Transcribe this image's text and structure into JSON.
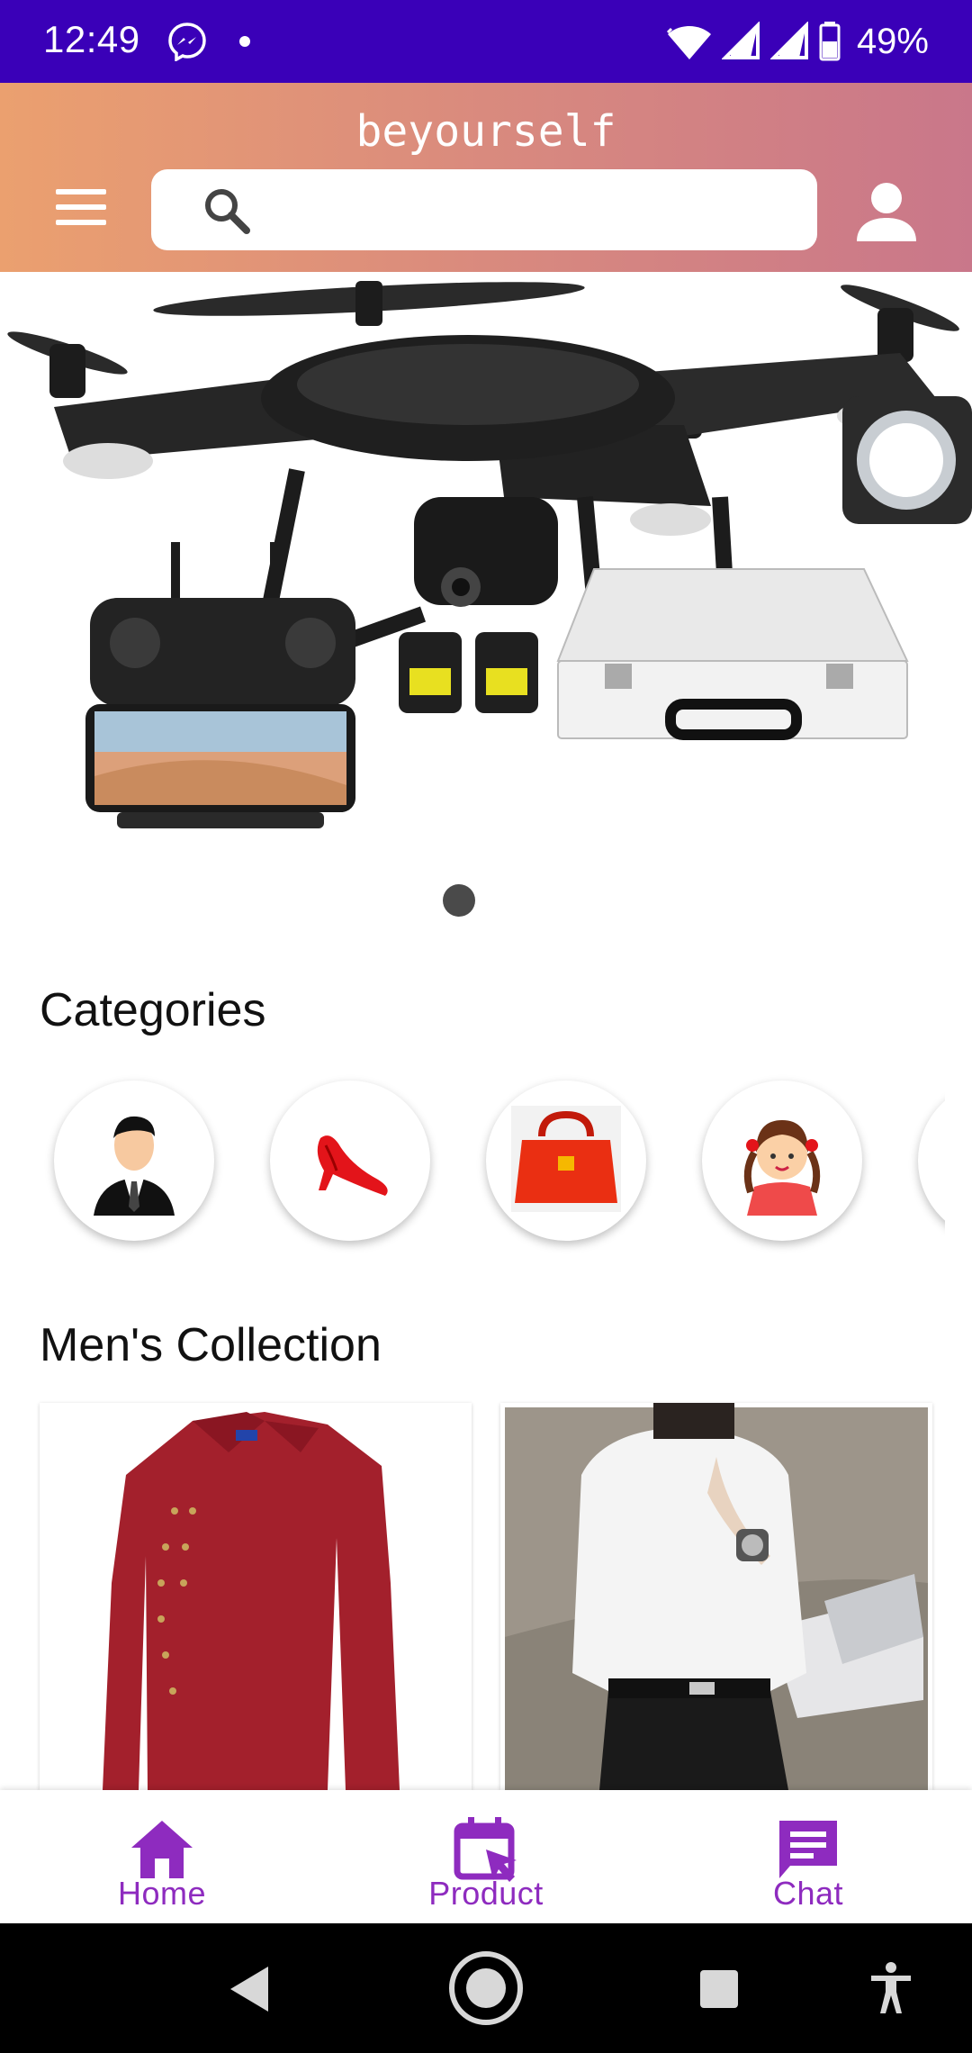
{
  "status_bar": {
    "time": "12:49",
    "battery": "49%",
    "icons": [
      "messenger-icon",
      "notification-dot",
      "wifi-icon",
      "signal-icon",
      "signal-icon",
      "battery-icon"
    ]
  },
  "header": {
    "title": "beyourself",
    "search": {
      "value": "",
      "placeholder": ""
    },
    "icons": [
      "menu-icon",
      "search-icon",
      "profile-icon"
    ]
  },
  "banner": {
    "image": "drone-product-banner",
    "slide_indicator_active": 1
  },
  "categories": {
    "title": "Categories",
    "items": [
      {
        "icon": "businessman-icon"
      },
      {
        "icon": "high-heel-shoe-icon"
      },
      {
        "icon": "handbag-icon"
      },
      {
        "icon": "girl-icon"
      },
      {
        "icon": "category-icon"
      }
    ]
  },
  "mens_collection": {
    "title": "Men's Collection",
    "products": [
      {
        "image": "red-shirt-image"
      },
      {
        "image": "white-shirt-image"
      }
    ]
  },
  "bottom_nav": {
    "items": [
      {
        "label": "Home",
        "icon": "home-icon"
      },
      {
        "label": "Product",
        "icon": "calendar-cursor-icon"
      },
      {
        "label": "Chat",
        "icon": "chat-icon"
      }
    ],
    "color": "#8e2bbf"
  },
  "colors": {
    "status_bar": "#3a00b8",
    "header_gradient_start": "#eba06f",
    "header_gradient_end": "#c9778a",
    "accent": "#8e2bbf"
  }
}
